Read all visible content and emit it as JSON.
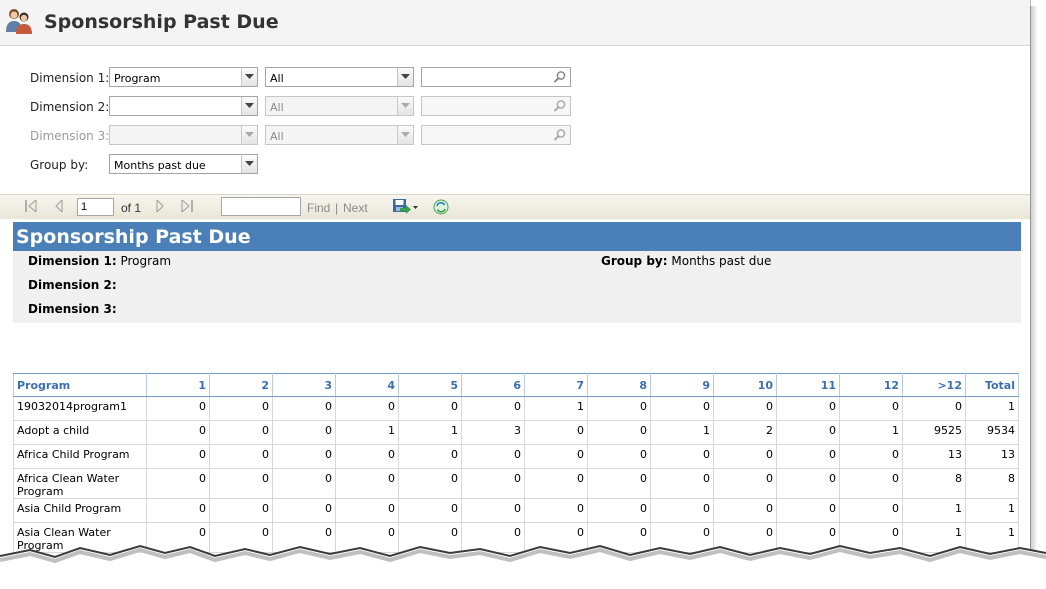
{
  "header": {
    "title": "Sponsorship Past Due",
    "icon": "people-icon"
  },
  "params": {
    "dimension1": {
      "label": "Dimension 1:",
      "value": "Program",
      "filter": "All",
      "search": ""
    },
    "dimension2": {
      "label": "Dimension 2:",
      "value": "",
      "filter": "All",
      "search": ""
    },
    "dimension3": {
      "label": "Dimension 3:",
      "value": "",
      "filter": "All",
      "search": ""
    },
    "group_by": {
      "label": "Group by:",
      "value": "Months past due"
    }
  },
  "toolbar": {
    "page": "1",
    "of_label": "of 1",
    "find_label": "Find",
    "separator": "|",
    "next_label": "Next"
  },
  "report": {
    "title": "Sponsorship Past Due",
    "dimension1_label": "Dimension 1:",
    "dimension1_value": "Program",
    "dimension2_label": "Dimension 2:",
    "dimension3_label": "Dimension 3:",
    "group_by_label": "Group by:",
    "group_by_value": "Months past due"
  },
  "table": {
    "headers": [
      "Program",
      "1",
      "2",
      "3",
      "4",
      "5",
      "6",
      "7",
      "8",
      "9",
      "10",
      "11",
      "12",
      ">12",
      "Total"
    ],
    "rows": [
      [
        "19032014program1",
        "0",
        "0",
        "0",
        "0",
        "0",
        "0",
        "1",
        "0",
        "0",
        "0",
        "0",
        "0",
        "0",
        "1"
      ],
      [
        "Adopt a child",
        "0",
        "0",
        "0",
        "1",
        "1",
        "3",
        "0",
        "0",
        "1",
        "2",
        "0",
        "1",
        "9525",
        "9534"
      ],
      [
        "Africa Child Program",
        "0",
        "0",
        "0",
        "0",
        "0",
        "0",
        "0",
        "0",
        "0",
        "0",
        "0",
        "0",
        "13",
        "13"
      ],
      [
        "Africa Clean Water Program",
        "0",
        "0",
        "0",
        "0",
        "0",
        "0",
        "0",
        "0",
        "0",
        "0",
        "0",
        "0",
        "8",
        "8"
      ],
      [
        "Asia Child Program",
        "0",
        "0",
        "0",
        "0",
        "0",
        "0",
        "0",
        "0",
        "0",
        "0",
        "0",
        "0",
        "1",
        "1"
      ],
      [
        "Asia Clean Water Program",
        "0",
        "0",
        "0",
        "0",
        "0",
        "0",
        "0",
        "0",
        "0",
        "0",
        "0",
        "0",
        "1",
        "1"
      ]
    ]
  },
  "colors": {
    "report_title_bg": "#4a80b7",
    "header_text": "#3a6fb0"
  }
}
